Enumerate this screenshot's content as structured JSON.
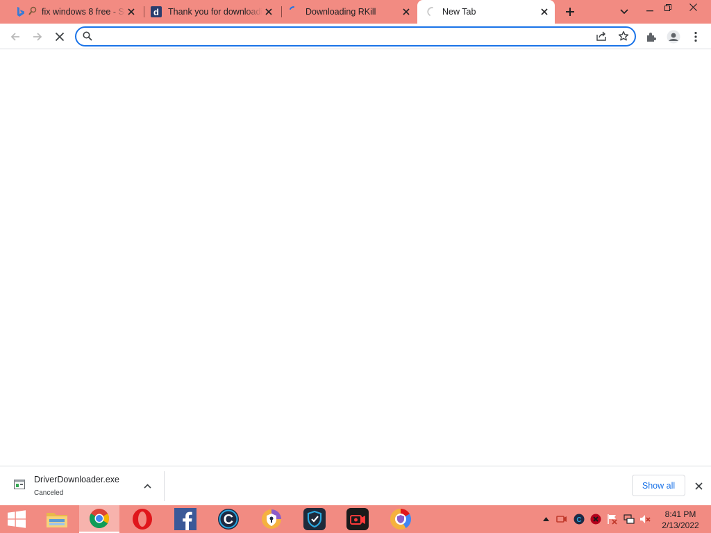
{
  "browser": {
    "tabs": [
      {
        "title": "fix windows 8 free - Se",
        "favicon": "bing-search-icon"
      },
      {
        "title": "Thank you for downloadi",
        "favicon": "d-site-icon"
      },
      {
        "title": "Downloading RKill",
        "favicon": "loading-icon"
      },
      {
        "title": "New Tab",
        "favicon": "loading-spinner-icon",
        "active": true
      }
    ],
    "new_tab_icon": "plus-icon",
    "tab_search_icon": "chevron-down-icon",
    "window_controls": [
      "minimize-icon",
      "restore-icon",
      "close-icon"
    ]
  },
  "toolbar": {
    "omnibox_value": "",
    "omnibox_placeholder": "",
    "icons": [
      "back-icon",
      "forward-icon",
      "stop-icon",
      "search-icon",
      "share-icon",
      "star-icon",
      "extensions-icon",
      "profile-icon",
      "menu-icon"
    ]
  },
  "download_shelf": {
    "file_name": "DriverDownloader.exe",
    "status": "Canceled",
    "show_all_label": "Show all"
  },
  "taskbar": {
    "apps": [
      "start-icon",
      "file-explorer-icon",
      "chrome-icon",
      "opera-icon",
      "facebook-icon",
      "ccleaner-icon",
      "vpn-shield-icon",
      "defender-icon",
      "screen-recorder-icon",
      "chrome-canary-icon"
    ],
    "tray": [
      "show-hidden-icon",
      "recorder-tray-icon",
      "ccleaner-tray-icon",
      "red-app-tray-icon",
      "flag-icon",
      "network-icon",
      "volume-muted-icon"
    ],
    "time": "8:41 PM",
    "date": "2/13/2022"
  },
  "colors": {
    "frame": "#f28b82",
    "accent": "#1a73e8"
  }
}
